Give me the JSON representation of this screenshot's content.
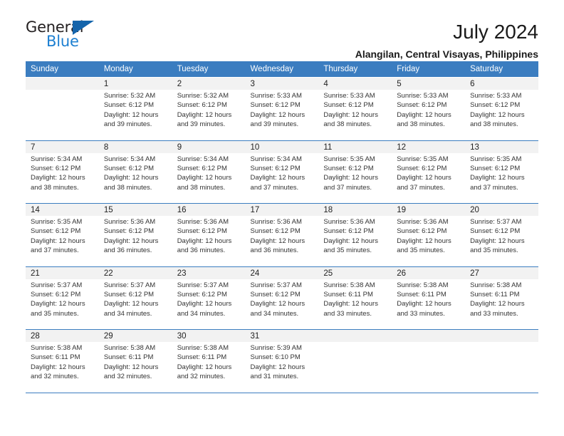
{
  "logo": {
    "text_primary": "General",
    "text_secondary": "Blue",
    "primary_color": "#231f20",
    "secondary_color": "#1c7fd1",
    "triangle_color": "#1464ab"
  },
  "header": {
    "title": "July 2024",
    "subtitle": "Alangilan, Central Visayas, Philippines"
  },
  "theme": {
    "header_bg": "#3b7dc0",
    "header_text": "#ffffff",
    "daynum_bg": "#f2f2f2",
    "cell_bg": "#ffffff",
    "rule_color": "#3b7dc0"
  },
  "columns": [
    "Sunday",
    "Monday",
    "Tuesday",
    "Wednesday",
    "Thursday",
    "Friday",
    "Saturday"
  ],
  "weeks": [
    [
      {
        "day": "",
        "lines": []
      },
      {
        "day": "1",
        "lines": [
          "Sunrise: 5:32 AM",
          "Sunset: 6:12 PM",
          "Daylight: 12 hours",
          "and 39 minutes."
        ]
      },
      {
        "day": "2",
        "lines": [
          "Sunrise: 5:32 AM",
          "Sunset: 6:12 PM",
          "Daylight: 12 hours",
          "and 39 minutes."
        ]
      },
      {
        "day": "3",
        "lines": [
          "Sunrise: 5:33 AM",
          "Sunset: 6:12 PM",
          "Daylight: 12 hours",
          "and 39 minutes."
        ]
      },
      {
        "day": "4",
        "lines": [
          "Sunrise: 5:33 AM",
          "Sunset: 6:12 PM",
          "Daylight: 12 hours",
          "and 38 minutes."
        ]
      },
      {
        "day": "5",
        "lines": [
          "Sunrise: 5:33 AM",
          "Sunset: 6:12 PM",
          "Daylight: 12 hours",
          "and 38 minutes."
        ]
      },
      {
        "day": "6",
        "lines": [
          "Sunrise: 5:33 AM",
          "Sunset: 6:12 PM",
          "Daylight: 12 hours",
          "and 38 minutes."
        ]
      }
    ],
    [
      {
        "day": "7",
        "lines": [
          "Sunrise: 5:34 AM",
          "Sunset: 6:12 PM",
          "Daylight: 12 hours",
          "and 38 minutes."
        ]
      },
      {
        "day": "8",
        "lines": [
          "Sunrise: 5:34 AM",
          "Sunset: 6:12 PM",
          "Daylight: 12 hours",
          "and 38 minutes."
        ]
      },
      {
        "day": "9",
        "lines": [
          "Sunrise: 5:34 AM",
          "Sunset: 6:12 PM",
          "Daylight: 12 hours",
          "and 38 minutes."
        ]
      },
      {
        "day": "10",
        "lines": [
          "Sunrise: 5:34 AM",
          "Sunset: 6:12 PM",
          "Daylight: 12 hours",
          "and 37 minutes."
        ]
      },
      {
        "day": "11",
        "lines": [
          "Sunrise: 5:35 AM",
          "Sunset: 6:12 PM",
          "Daylight: 12 hours",
          "and 37 minutes."
        ]
      },
      {
        "day": "12",
        "lines": [
          "Sunrise: 5:35 AM",
          "Sunset: 6:12 PM",
          "Daylight: 12 hours",
          "and 37 minutes."
        ]
      },
      {
        "day": "13",
        "lines": [
          "Sunrise: 5:35 AM",
          "Sunset: 6:12 PM",
          "Daylight: 12 hours",
          "and 37 minutes."
        ]
      }
    ],
    [
      {
        "day": "14",
        "lines": [
          "Sunrise: 5:35 AM",
          "Sunset: 6:12 PM",
          "Daylight: 12 hours",
          "and 37 minutes."
        ]
      },
      {
        "day": "15",
        "lines": [
          "Sunrise: 5:36 AM",
          "Sunset: 6:12 PM",
          "Daylight: 12 hours",
          "and 36 minutes."
        ]
      },
      {
        "day": "16",
        "lines": [
          "Sunrise: 5:36 AM",
          "Sunset: 6:12 PM",
          "Daylight: 12 hours",
          "and 36 minutes."
        ]
      },
      {
        "day": "17",
        "lines": [
          "Sunrise: 5:36 AM",
          "Sunset: 6:12 PM",
          "Daylight: 12 hours",
          "and 36 minutes."
        ]
      },
      {
        "day": "18",
        "lines": [
          "Sunrise: 5:36 AM",
          "Sunset: 6:12 PM",
          "Daylight: 12 hours",
          "and 35 minutes."
        ]
      },
      {
        "day": "19",
        "lines": [
          "Sunrise: 5:36 AM",
          "Sunset: 6:12 PM",
          "Daylight: 12 hours",
          "and 35 minutes."
        ]
      },
      {
        "day": "20",
        "lines": [
          "Sunrise: 5:37 AM",
          "Sunset: 6:12 PM",
          "Daylight: 12 hours",
          "and 35 minutes."
        ]
      }
    ],
    [
      {
        "day": "21",
        "lines": [
          "Sunrise: 5:37 AM",
          "Sunset: 6:12 PM",
          "Daylight: 12 hours",
          "and 35 minutes."
        ]
      },
      {
        "day": "22",
        "lines": [
          "Sunrise: 5:37 AM",
          "Sunset: 6:12 PM",
          "Daylight: 12 hours",
          "and 34 minutes."
        ]
      },
      {
        "day": "23",
        "lines": [
          "Sunrise: 5:37 AM",
          "Sunset: 6:12 PM",
          "Daylight: 12 hours",
          "and 34 minutes."
        ]
      },
      {
        "day": "24",
        "lines": [
          "Sunrise: 5:37 AM",
          "Sunset: 6:12 PM",
          "Daylight: 12 hours",
          "and 34 minutes."
        ]
      },
      {
        "day": "25",
        "lines": [
          "Sunrise: 5:38 AM",
          "Sunset: 6:11 PM",
          "Daylight: 12 hours",
          "and 33 minutes."
        ]
      },
      {
        "day": "26",
        "lines": [
          "Sunrise: 5:38 AM",
          "Sunset: 6:11 PM",
          "Daylight: 12 hours",
          "and 33 minutes."
        ]
      },
      {
        "day": "27",
        "lines": [
          "Sunrise: 5:38 AM",
          "Sunset: 6:11 PM",
          "Daylight: 12 hours",
          "and 33 minutes."
        ]
      }
    ],
    [
      {
        "day": "28",
        "lines": [
          "Sunrise: 5:38 AM",
          "Sunset: 6:11 PM",
          "Daylight: 12 hours",
          "and 32 minutes."
        ]
      },
      {
        "day": "29",
        "lines": [
          "Sunrise: 5:38 AM",
          "Sunset: 6:11 PM",
          "Daylight: 12 hours",
          "and 32 minutes."
        ]
      },
      {
        "day": "30",
        "lines": [
          "Sunrise: 5:38 AM",
          "Sunset: 6:11 PM",
          "Daylight: 12 hours",
          "and 32 minutes."
        ]
      },
      {
        "day": "31",
        "lines": [
          "Sunrise: 5:39 AM",
          "Sunset: 6:10 PM",
          "Daylight: 12 hours",
          "and 31 minutes."
        ]
      },
      {
        "day": "",
        "lines": []
      },
      {
        "day": "",
        "lines": []
      },
      {
        "day": "",
        "lines": []
      }
    ]
  ]
}
